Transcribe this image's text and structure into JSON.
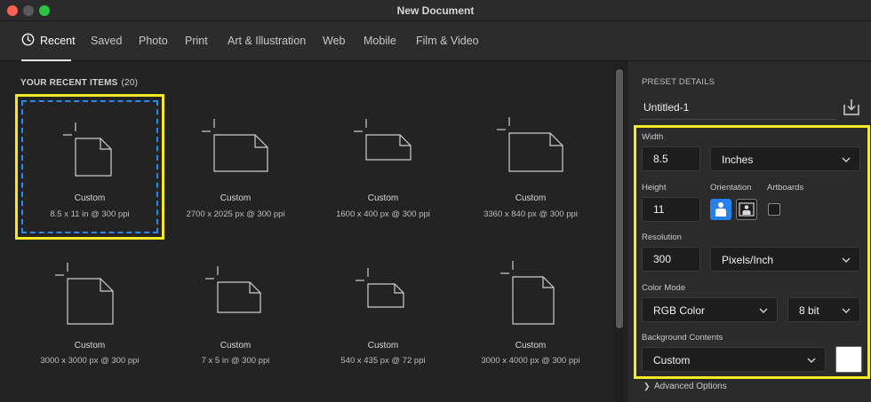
{
  "window": {
    "title": "New Document"
  },
  "tabs": [
    {
      "label": "Recent"
    },
    {
      "label": "Saved"
    },
    {
      "label": "Photo"
    },
    {
      "label": "Print"
    },
    {
      "label": "Art & Illustration"
    },
    {
      "label": "Web"
    },
    {
      "label": "Mobile"
    },
    {
      "label": "Film & Video"
    }
  ],
  "recent": {
    "title": "YOUR RECENT ITEMS",
    "count": "(20)",
    "items": [
      {
        "name": "Custom",
        "size": "8.5 x 11 in @ 300 ppi"
      },
      {
        "name": "Custom",
        "size": "2700 x 2025 px @ 300 ppi"
      },
      {
        "name": "Custom",
        "size": "1600 x 400 px @ 300 ppi"
      },
      {
        "name": "Custom",
        "size": "3360 x 840 px @ 300 ppi"
      },
      {
        "name": "Custom",
        "size": "3000 x 3000 px @ 300 ppi"
      },
      {
        "name": "Custom",
        "size": "7 x 5 in @ 300 ppi"
      },
      {
        "name": "Custom",
        "size": "540 x 435 px @ 72 ppi"
      },
      {
        "name": "Custom",
        "size": "3000 x 4000 px @ 300 ppi"
      }
    ]
  },
  "preset": {
    "title": "PRESET DETAILS",
    "name": "Untitled-1",
    "width_label": "Width",
    "width_value": "8.5",
    "width_unit": "Inches",
    "height_label": "Height",
    "height_value": "11",
    "orientation_label": "Orientation",
    "artboards_label": "Artboards",
    "resolution_label": "Resolution",
    "resolution_value": "300",
    "resolution_unit": "Pixels/Inch",
    "color_mode_label": "Color Mode",
    "color_mode": "RGB Color",
    "bit_depth": "8 bit",
    "background_label": "Background Contents",
    "background": "Custom",
    "advanced_label": "Advanced Options"
  },
  "colors": {
    "highlight": "#f5e827",
    "selection": "#2a8af3",
    "accent": "#2680eb",
    "background_swatch": "#ffffff"
  }
}
